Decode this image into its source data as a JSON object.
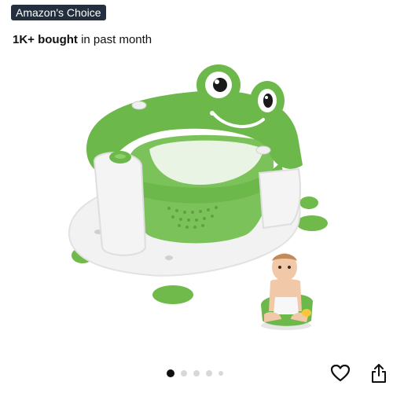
{
  "badge": {
    "label": "Amazon's Choice"
  },
  "purchase_info": {
    "bold": "1K+ bought",
    "rest": " in past month"
  },
  "gallery": {
    "image_count": 5,
    "active_index": 0
  },
  "icons": {
    "favorite": "heart-outline-icon",
    "share": "share-icon"
  },
  "colors": {
    "badge_bg": "#232f3e",
    "product_green": "#6cb84a",
    "dot_active": "#0f1111"
  }
}
